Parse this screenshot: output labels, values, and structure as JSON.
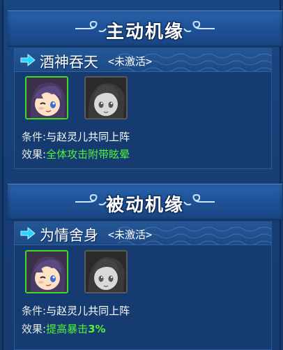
{
  "sections": [
    {
      "title": "主动机缘",
      "fate": {
        "name": "酒神吞天",
        "status": "<未激活>",
        "condition_label": "条件:",
        "condition_value": "与赵灵儿共同上阵",
        "effect_label": "效果:",
        "effect_value": "全体攻击附带眩晕",
        "effect_bold": ""
      }
    },
    {
      "title": "被动机缘",
      "fate": {
        "name": "为情舍身",
        "status": "<未激活>",
        "condition_label": "条件:",
        "condition_value": "与赵灵儿共同上阵",
        "effect_label": "效果:",
        "effect_value": "提高暴击",
        "effect_bold": "3%"
      }
    }
  ],
  "colors": {
    "background": "#15396a",
    "header": "#1e5298",
    "highlight_green": "#52f23a",
    "active_border": "#3edb22",
    "inactive_border": "#5a5a5a"
  },
  "icons": {
    "arrow": "arrow-right-icon",
    "swirl": "cloud-swirl-ornament"
  }
}
